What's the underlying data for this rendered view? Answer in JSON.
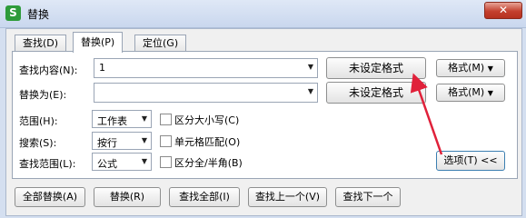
{
  "window": {
    "title": "替换",
    "app_icon": "S",
    "close": "✕"
  },
  "tabs": [
    {
      "label": "查找(D)",
      "active": false
    },
    {
      "label": "替换(P)",
      "active": true
    },
    {
      "label": "定位(G)",
      "active": false
    }
  ],
  "find": {
    "label": "查找内容(N):",
    "value": "1",
    "format_status": "未设定格式",
    "format_button": "格式(M)"
  },
  "replace": {
    "label": "替换为(E):",
    "value": "",
    "format_status": "未设定格式",
    "format_button": "格式(M)"
  },
  "options": {
    "scope": {
      "label": "范围(H):",
      "value": "工作表"
    },
    "search": {
      "label": "搜索(S):",
      "value": "按行"
    },
    "look_in": {
      "label": "查找范围(L):",
      "value": "公式"
    },
    "match_case": {
      "label": "区分大小写(C)",
      "checked": false
    },
    "match_cell": {
      "label": "单元格匹配(O)",
      "checked": false
    },
    "match_width": {
      "label": "区分全/半角(B)",
      "checked": false
    },
    "toggle_button": "选项(T) <<"
  },
  "footer": {
    "replace_all": "全部替换(A)",
    "replace": "替换(R)",
    "find_all": "查找全部(I)",
    "find_prev": "查找上一个(V)",
    "find_next": "查找下一个"
  },
  "colors": {
    "annotation_arrow": "#e0213a",
    "close_button": "#c4412f"
  },
  "icons": {
    "dropdown": "▼",
    "checkbox": "unchecked"
  }
}
